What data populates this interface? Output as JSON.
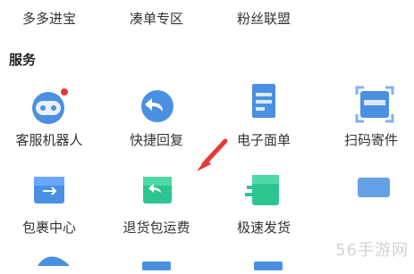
{
  "top_row": [
    "多多进宝",
    "凑单专区",
    "粉丝联盟"
  ],
  "section": {
    "title": "服务"
  },
  "items": [
    {
      "label": "客服机器人",
      "icon": "robot-icon"
    },
    {
      "label": "快捷回复",
      "icon": "reply-icon"
    },
    {
      "label": "电子面单",
      "icon": "waybill-icon"
    },
    {
      "label": "扫码寄件",
      "icon": "scan-icon"
    },
    {
      "label": "包裹中心",
      "icon": "package-center-icon"
    },
    {
      "label": "退货包运费",
      "icon": "return-shipping-icon"
    },
    {
      "label": "极速发货",
      "icon": "fast-ship-icon"
    }
  ],
  "watermark": "56手游网",
  "colors": {
    "blue": "#4a90e2",
    "green": "#2ec48f",
    "red": "#e53935"
  }
}
